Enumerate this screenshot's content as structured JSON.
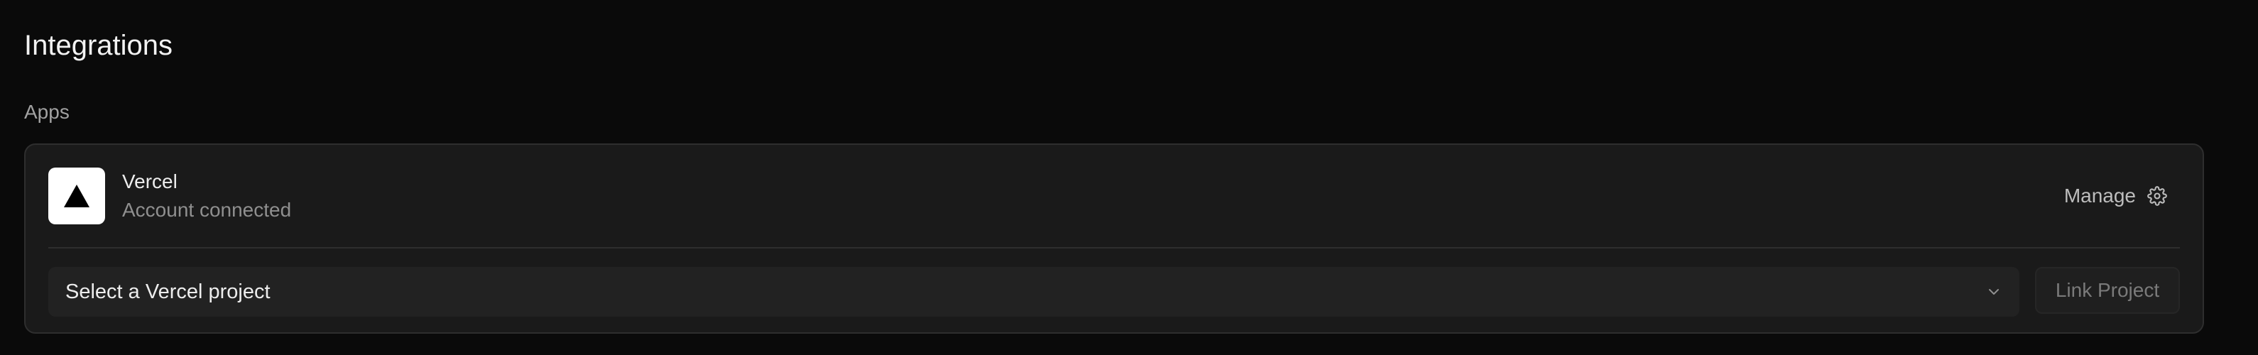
{
  "page": {
    "title": "Integrations",
    "section_label": "Apps"
  },
  "integration": {
    "app_name": "Vercel",
    "status": "Account connected",
    "logo_icon": "vercel-triangle-icon",
    "manage_label": "Manage",
    "manage_icon": "gear-icon"
  },
  "project_select": {
    "value": "Select a Vercel project",
    "icon": "chevron-down-icon"
  },
  "link_button": {
    "label": "Link Project",
    "disabled": true
  },
  "colors": {
    "background": "#0a0a0a",
    "card": "#1a1a1a",
    "border": "#2e2e2e",
    "text_primary": "#ededed",
    "text_secondary": "#8f8f8f"
  }
}
